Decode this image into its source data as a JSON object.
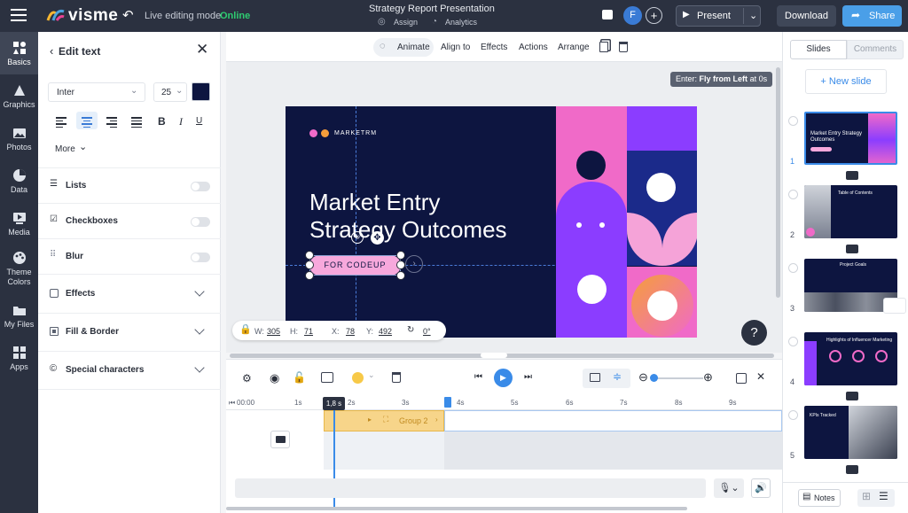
{
  "topbar": {
    "brand": "visme",
    "mode_label": "Live editing mode",
    "mode_status": "Online",
    "doc_title": "Strategy Report Presentation",
    "assign_label": "Assign",
    "analytics_label": "Analytics",
    "avatar_initial": "F",
    "present_label": "Present",
    "download_label": "Download",
    "share_label": "Share"
  },
  "rail": [
    {
      "label": "Basics"
    },
    {
      "label": "Graphics"
    },
    {
      "label": "Photos"
    },
    {
      "label": "Data"
    },
    {
      "label": "Media"
    },
    {
      "label": "Theme Colors"
    },
    {
      "label": "My Files"
    },
    {
      "label": "Apps"
    }
  ],
  "panel": {
    "title": "Edit text",
    "font_family": "Inter",
    "font_size": "25",
    "text_color": "#0d1540",
    "more_label": "More",
    "sections": [
      {
        "label": "Lists",
        "kind": "toggle"
      },
      {
        "label": "Checkboxes",
        "kind": "toggle"
      },
      {
        "label": "Blur",
        "kind": "toggle"
      },
      {
        "label": "Effects",
        "kind": "expand"
      },
      {
        "label": "Fill & Border",
        "kind": "expand"
      },
      {
        "label": "Special characters",
        "kind": "expand"
      }
    ]
  },
  "toolbar": {
    "animate": "Animate",
    "align_to": "Align to",
    "effects": "Effects",
    "actions": "Actions",
    "arrange": "Arrange"
  },
  "anim_hint": {
    "prefix": "Enter:",
    "bold": "Fly from Left",
    "suffix": "at 0s"
  },
  "slide": {
    "brand": "MARKETRM",
    "title_line1": "Market Entry",
    "title_line2": "Strategy Outcomes",
    "button": "FOR CODEUP"
  },
  "dims": {
    "w_label": "W:",
    "w": "305",
    "h_label": "H:",
    "h": "71",
    "x_label": "X:",
    "x": "78",
    "y_label": "Y:",
    "y": "492",
    "rot": "0°"
  },
  "help_label": "?",
  "timeline": {
    "playhead": "1,8 s",
    "ticks": [
      "00:00",
      "1s",
      "2s",
      "3s",
      "4s",
      "5s",
      "6s",
      "7s",
      "8s",
      "9s"
    ],
    "track_label": "Group 2"
  },
  "right": {
    "tab_slides": "Slides",
    "tab_comments": "Comments",
    "new_slide": "+ New slide",
    "slides": [
      {
        "num": "1",
        "title": "Market Entry Strategy Outcomes"
      },
      {
        "num": "2",
        "title": "Table of Contents"
      },
      {
        "num": "3",
        "title": "Project Goals"
      },
      {
        "num": "4",
        "title": "Highlights of Influencer Marketing"
      },
      {
        "num": "5",
        "title": "KPIs Tracked"
      }
    ],
    "notes_label": "Notes"
  }
}
